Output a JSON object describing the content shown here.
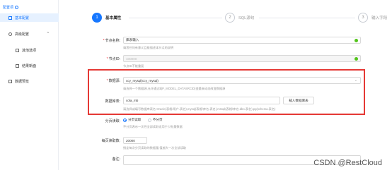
{
  "sidebar": {
    "header": "配置项",
    "items": [
      {
        "label": "基本配置",
        "active": true
      },
      {
        "label": "高级配置",
        "active": false,
        "caret": "^"
      },
      {
        "label": "其他选项",
        "active": false
      },
      {
        "label": "结果新面",
        "active": false
      },
      {
        "label": "数据预览",
        "active": false
      }
    ]
  },
  "steps": [
    {
      "num": "1",
      "label": "基本属性",
      "state": "done"
    },
    {
      "num": "2",
      "label": "SQL源句",
      "state": "todo"
    },
    {
      "num": "3",
      "label": "输入字段",
      "state": "todo"
    }
  ],
  "form": {
    "node_name": {
      "label": "节点名称:",
      "value": "库表输入",
      "hint": "请您任何有意义且能描述本节点的说明"
    },
    "node_id": {
      "label": "节点ID:",
      "value": "100000",
      "hint": "节点ID不能重复"
    },
    "datasource": {
      "label": "数据源:",
      "value": "ccy_mysql(ccy_mysql)",
      "hint": "请选择一个数据源,允许通过${P_MODEL_DATASRCID}变量来动态改变数据源"
    },
    "schema": {
      "label": "数据库表:",
      "value": "cola_mb",
      "button": "载入数据库表",
      "hint": "请选择或填写数据库表名 Oracle(表格/用户.表名),mysql(表格/库名.表名),mssql(表格/库名.dbo.表名),pg(schema.表名)"
    },
    "paging": {
      "label": "分页读取:",
      "options": [
        "分页读取",
        "不分页"
      ],
      "selected": 0,
      "hint": "不分页表示一次性全部读取适用于少批量数据"
    },
    "page_size": {
      "label": "每页读取数:",
      "value": "20000",
      "hint": "指定每次分页读取的数据量,值越大一次全部读取"
    },
    "remark": {
      "label": "备注:",
      "value": ""
    }
  },
  "watermark": "CSDN @RestCloud",
  "colors": {
    "accent": "#1677ff",
    "highlight_border": "#e53935",
    "success": "#52c41a"
  }
}
